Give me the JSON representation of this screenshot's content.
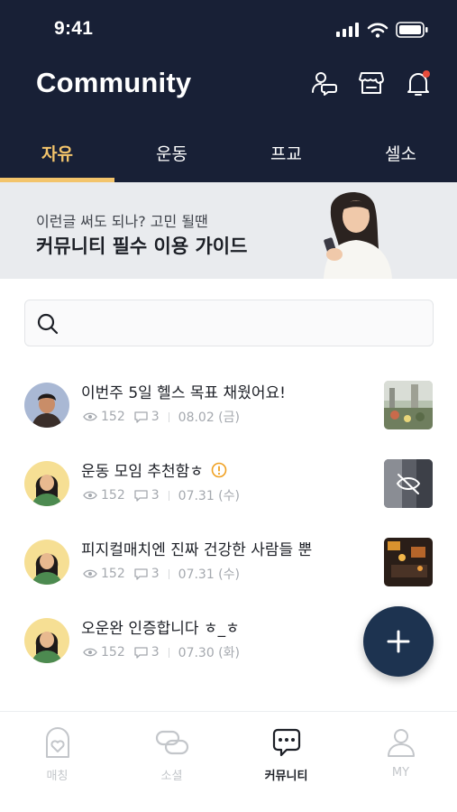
{
  "status_bar": {
    "time": "9:41"
  },
  "header": {
    "title": "Community",
    "actions": [
      {
        "icon": "user-chat-icon"
      },
      {
        "icon": "store-icon"
      },
      {
        "icon": "bell-icon",
        "badge": true
      }
    ]
  },
  "tabs": [
    {
      "label": "자유",
      "active": true
    },
    {
      "label": "운동",
      "active": false
    },
    {
      "label": "프교",
      "active": false
    },
    {
      "label": "셀소",
      "active": false
    }
  ],
  "banner": {
    "subtitle": "이런글 써도 되나? 고민 될땐",
    "title": "커뮤니티 필수 이용 가이드"
  },
  "search": {
    "placeholder": "",
    "value": ""
  },
  "posts": [
    {
      "title": "이번주 5일 헬스 목표 채웠어요!",
      "views": "152",
      "comments": "3",
      "date": "08.02 (금)",
      "avatar": "man-avatar",
      "thumb": "outdoor-photo",
      "warning": false
    },
    {
      "title": "운동 모임 추천함ㅎ",
      "views": "152",
      "comments": "3",
      "date": "07.31 (수)",
      "avatar": "woman-avatar",
      "thumb": "hidden-photo",
      "warning": true
    },
    {
      "title": "피지컬매치엔 진짜 건강한 사람들 뿐",
      "views": "152",
      "comments": "3",
      "date": "07.31 (수)",
      "avatar": "woman-avatar",
      "thumb": "night-photo",
      "warning": false
    },
    {
      "title": "오운완 인증합니다 ㅎ_ㅎ",
      "views": "152",
      "comments": "3",
      "date": "07.30 (화)",
      "avatar": "woman-avatar",
      "thumb": null,
      "warning": false
    }
  ],
  "fab": {
    "icon": "plus-icon"
  },
  "bottom_nav": [
    {
      "label": "매칭",
      "icon": "heart-badge-icon",
      "active": false
    },
    {
      "label": "소셜",
      "icon": "link-icon",
      "active": false
    },
    {
      "label": "커뮤니티",
      "icon": "chat-bubble-icon",
      "active": true
    },
    {
      "label": "MY",
      "icon": "person-icon",
      "active": false
    }
  ],
  "colors": {
    "header_bg": "#182036",
    "accent": "#f3c46b",
    "fab_bg": "#1d3350",
    "notification_dot": "#e74c3c"
  }
}
